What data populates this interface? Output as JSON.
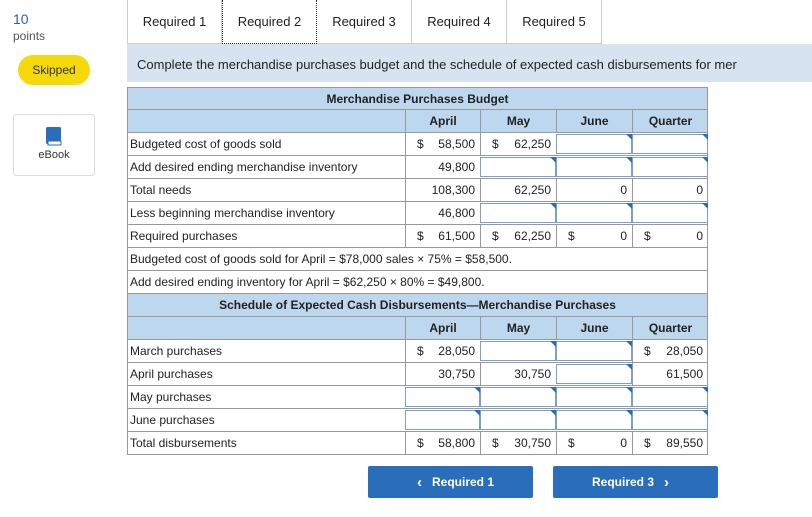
{
  "points": {
    "value": "10",
    "label": "points"
  },
  "status_badge": "Skipped",
  "ebook_label": "eBook",
  "tabs": [
    {
      "label": "Required 1",
      "active": false
    },
    {
      "label": "Required 2",
      "active": true
    },
    {
      "label": "Required 3",
      "active": false
    },
    {
      "label": "Required 4",
      "active": false
    },
    {
      "label": "Required 5",
      "active": false
    }
  ],
  "instruction": "Complete the merchandise purchases budget and the schedule of expected cash disbursements for mer",
  "budget": {
    "title": "Merchandise Purchases Budget",
    "columns": [
      "April",
      "May",
      "June",
      "Quarter"
    ],
    "rows": {
      "budgeted_cost": {
        "label": "Budgeted cost of goods sold",
        "april": "58,500",
        "may": "62,250",
        "june": "",
        "quarter": ""
      },
      "ending_inventory": {
        "label": "Add desired ending merchandise inventory",
        "april": "49,800",
        "may": "",
        "june": "",
        "quarter": ""
      },
      "total_needs": {
        "label": "Total needs",
        "april": "108,300",
        "may": "62,250",
        "june": "0",
        "quarter": "0"
      },
      "beginning_inventory": {
        "label": "Less beginning merchandise inventory",
        "april": "46,800",
        "may": "",
        "june": "",
        "quarter": ""
      },
      "required_purchases": {
        "label": "Required purchases",
        "april": "61,500",
        "may": "62,250",
        "june": "0",
        "quarter": "0"
      }
    },
    "notes": [
      "Budgeted cost of goods sold for April = $78,000 sales × 75% = $58,500.",
      "Add desired ending inventory for April = $62,250 × 80% = $49,800."
    ]
  },
  "schedule": {
    "title": "Schedule of Expected Cash Disbursements—Merchandise Purchases",
    "columns": [
      "April",
      "May",
      "June",
      "Quarter"
    ],
    "rows": {
      "march": {
        "label": "March purchases",
        "april": "28,050",
        "may": "",
        "june": "",
        "quarter": "28,050"
      },
      "april": {
        "label": "April purchases",
        "april": "30,750",
        "may": "30,750",
        "june": "",
        "quarter": "61,500"
      },
      "may": {
        "label": "May purchases",
        "april": "",
        "may": "",
        "june": "",
        "quarter": ""
      },
      "june": {
        "label": "June purchases",
        "april": "",
        "may": "",
        "june": "",
        "quarter": ""
      },
      "total": {
        "label": "Total disbursements",
        "april": "58,800",
        "may": "30,750",
        "june": "0",
        "quarter": "89,550"
      }
    }
  },
  "currency_symbol": "$",
  "nav": {
    "prev_label": "Required 1",
    "next_label": "Required 3"
  },
  "colors": {
    "accent": "#2a6ebb",
    "header_bg": "#bdd7ee",
    "badge": "#f5d90a",
    "instruction_bg": "#d7e3f0"
  }
}
